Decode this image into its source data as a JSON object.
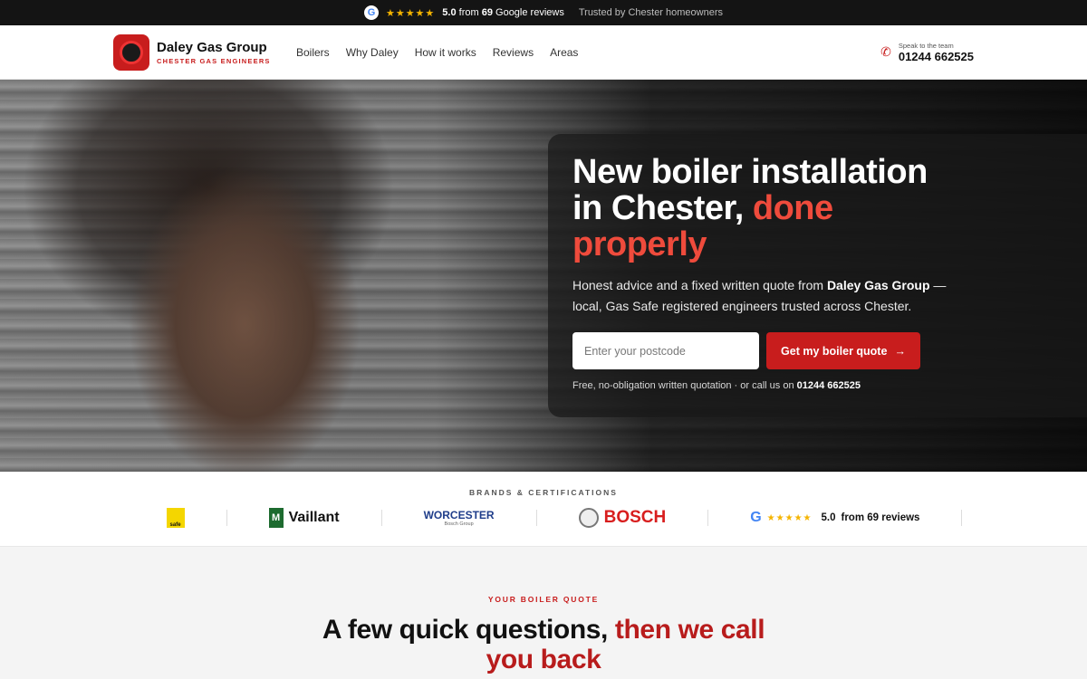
{
  "topbar": {
    "google_letter": "G",
    "stars": "★★★★★",
    "score": "5.0",
    "from_text": "from",
    "count": "69",
    "reviews_label": "Google reviews",
    "trusted": "Trusted by Chester homeowners"
  },
  "header": {
    "brand_name": "Daley Gas Group",
    "brand_sub": "CHESTER GAS ENGINEERS",
    "nav": [
      "Boilers",
      "Why Daley",
      "How it works",
      "Reviews",
      "Areas"
    ],
    "phone_icon": "phone-icon",
    "phone_label": "Speak to the team",
    "phone_number": "01244 662525"
  },
  "hero": {
    "title_main": "New boiler installation in Chester,",
    "title_accent": "done properly",
    "desc_prefix": "Honest advice and a fixed written quote from",
    "desc_brand": "Daley Gas Group",
    "desc_suffix": "— local, Gas Safe registered engineers trusted across Chester.",
    "postcode_placeholder": "Enter your postcode",
    "quote_button": "Get my boiler quote",
    "quote_arrow": "→",
    "note_prefix": "Free, no-obligation written quotation · or call us on",
    "note_phone": "01244 662525"
  },
  "brands": {
    "title": "BRANDS & CERTIFICATIONS",
    "gas_safe": "safe",
    "vaillant": "Vaillant",
    "vaillant_mark": "M",
    "worcester": "WORCESTER",
    "worcester_sub": "Bosch Group",
    "bosch": "BOSCH",
    "google_letter": "G",
    "stars": "★★★★★",
    "score": "5.0",
    "reviews": "from 69 reviews"
  },
  "quote_section": {
    "eyebrow": "YOUR BOILER QUOTE",
    "title_main": "A few quick questions,",
    "title_accent": "then we call you back"
  },
  "colors": {
    "accent": "#c81d1d",
    "hero_accent": "#ef4b3c",
    "star": "#f5b400"
  }
}
